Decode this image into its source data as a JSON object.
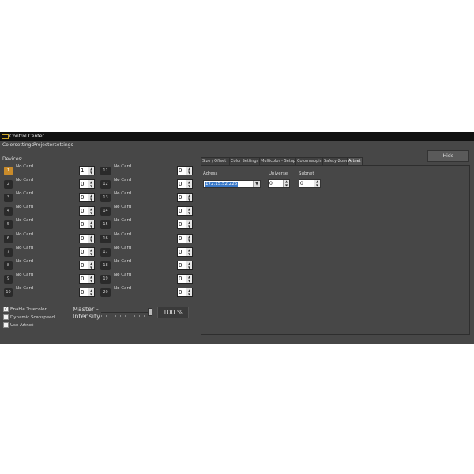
{
  "window": {
    "title": "Control Center"
  },
  "menu": {
    "items": [
      "Colorsettings",
      "Projectorsettings"
    ]
  },
  "devices": {
    "label": "Devices:",
    "left": [
      {
        "number": "1",
        "status": "No Card",
        "value": "1",
        "active": true
      },
      {
        "number": "2",
        "status": "No Card",
        "value": "0"
      },
      {
        "number": "3",
        "status": "No Card",
        "value": "0"
      },
      {
        "number": "4",
        "status": "No Card",
        "value": "0"
      },
      {
        "number": "5",
        "status": "No Card",
        "value": "0"
      },
      {
        "number": "6",
        "status": "No Card",
        "value": "0"
      },
      {
        "number": "7",
        "status": "No Card",
        "value": "0"
      },
      {
        "number": "8",
        "status": "No Card",
        "value": "0"
      },
      {
        "number": "9",
        "status": "No Card",
        "value": "0"
      },
      {
        "number": "10",
        "status": "No Card",
        "value": "0"
      }
    ],
    "right": [
      {
        "number": "11",
        "status": "No Card",
        "value": "0"
      },
      {
        "number": "12",
        "status": "No Card",
        "value": "0"
      },
      {
        "number": "13",
        "status": "No Card",
        "value": "0"
      },
      {
        "number": "14",
        "status": "No Card",
        "value": "0"
      },
      {
        "number": "15",
        "status": "No Card",
        "value": "0"
      },
      {
        "number": "16",
        "status": "No Card",
        "value": "0"
      },
      {
        "number": "17",
        "status": "No Card",
        "value": "0"
      },
      {
        "number": "18",
        "status": "No Card",
        "value": "0"
      },
      {
        "number": "19",
        "status": "No Card",
        "value": "0"
      },
      {
        "number": "20",
        "status": "No Card",
        "value": "0"
      }
    ]
  },
  "options": {
    "enable_truecolor": {
      "label": "Enable Truecolor",
      "checked": true
    },
    "dynamic_scanspeed": {
      "label": "Dynamic Scanspeed",
      "checked": false
    },
    "use_artnet": {
      "label": "Use Artnet",
      "checked": false
    }
  },
  "master": {
    "label_line1": "Master -",
    "label_line2": "Intensity",
    "value_text": "100 %",
    "level": 1.0
  },
  "hide_button": "Hide",
  "tabs": [
    "Size / Offset",
    "Color Settings",
    "Multicolor - Setup",
    "Colormapping",
    "Safety-Zone",
    "Artnet"
  ],
  "active_tab": "Artnet",
  "artnet": {
    "address_label": "Adress",
    "address_value": "172.15.52.225",
    "universe_label": "Universe",
    "universe_value": "0",
    "subnet_label": "Subnet",
    "subnet_value": "0"
  },
  "colors": {
    "window_bg": "#474747",
    "titlebar_bg": "#111111",
    "active_device": "#c98b2a",
    "selection": "#3b7ac9"
  }
}
